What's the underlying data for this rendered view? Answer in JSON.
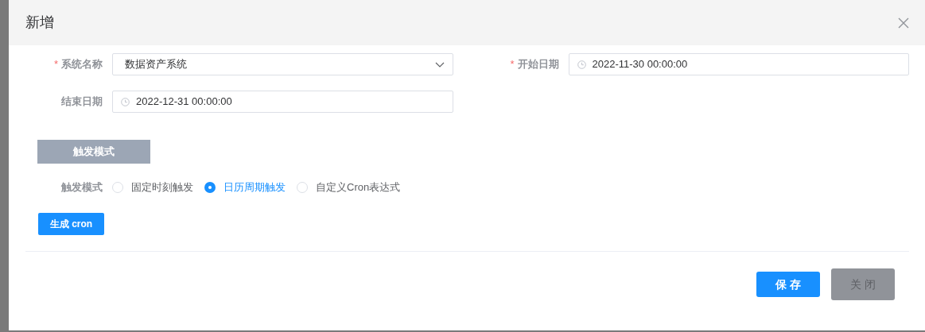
{
  "dialog": {
    "title": "新增"
  },
  "fields": [
    {
      "label": "系统名称",
      "kind": "select",
      "required_mark": "*",
      "value": "数据资产系统"
    },
    {
      "label": "开始日期",
      "kind": "date",
      "required_mark": "*",
      "value": "2022-11-30 00:00:00"
    },
    {
      "label": "结束日期",
      "kind": "date",
      "value": "2022-12-31 00:00:00"
    }
  ],
  "section": {
    "label": "触发模式"
  },
  "trigger": {
    "label": "触发模式",
    "options": [
      {
        "label": "固定时刻触发",
        "selected": false
      },
      {
        "label": "日历周期触发",
        "selected": true
      },
      {
        "label": "自定义Cron表达式",
        "selected": false
      }
    ]
  },
  "generate_button": "生成 cron",
  "footer_buttons": [
    {
      "label": "保 存",
      "kind": "primary"
    },
    {
      "label": "关 闭",
      "kind": "muted"
    }
  ]
}
